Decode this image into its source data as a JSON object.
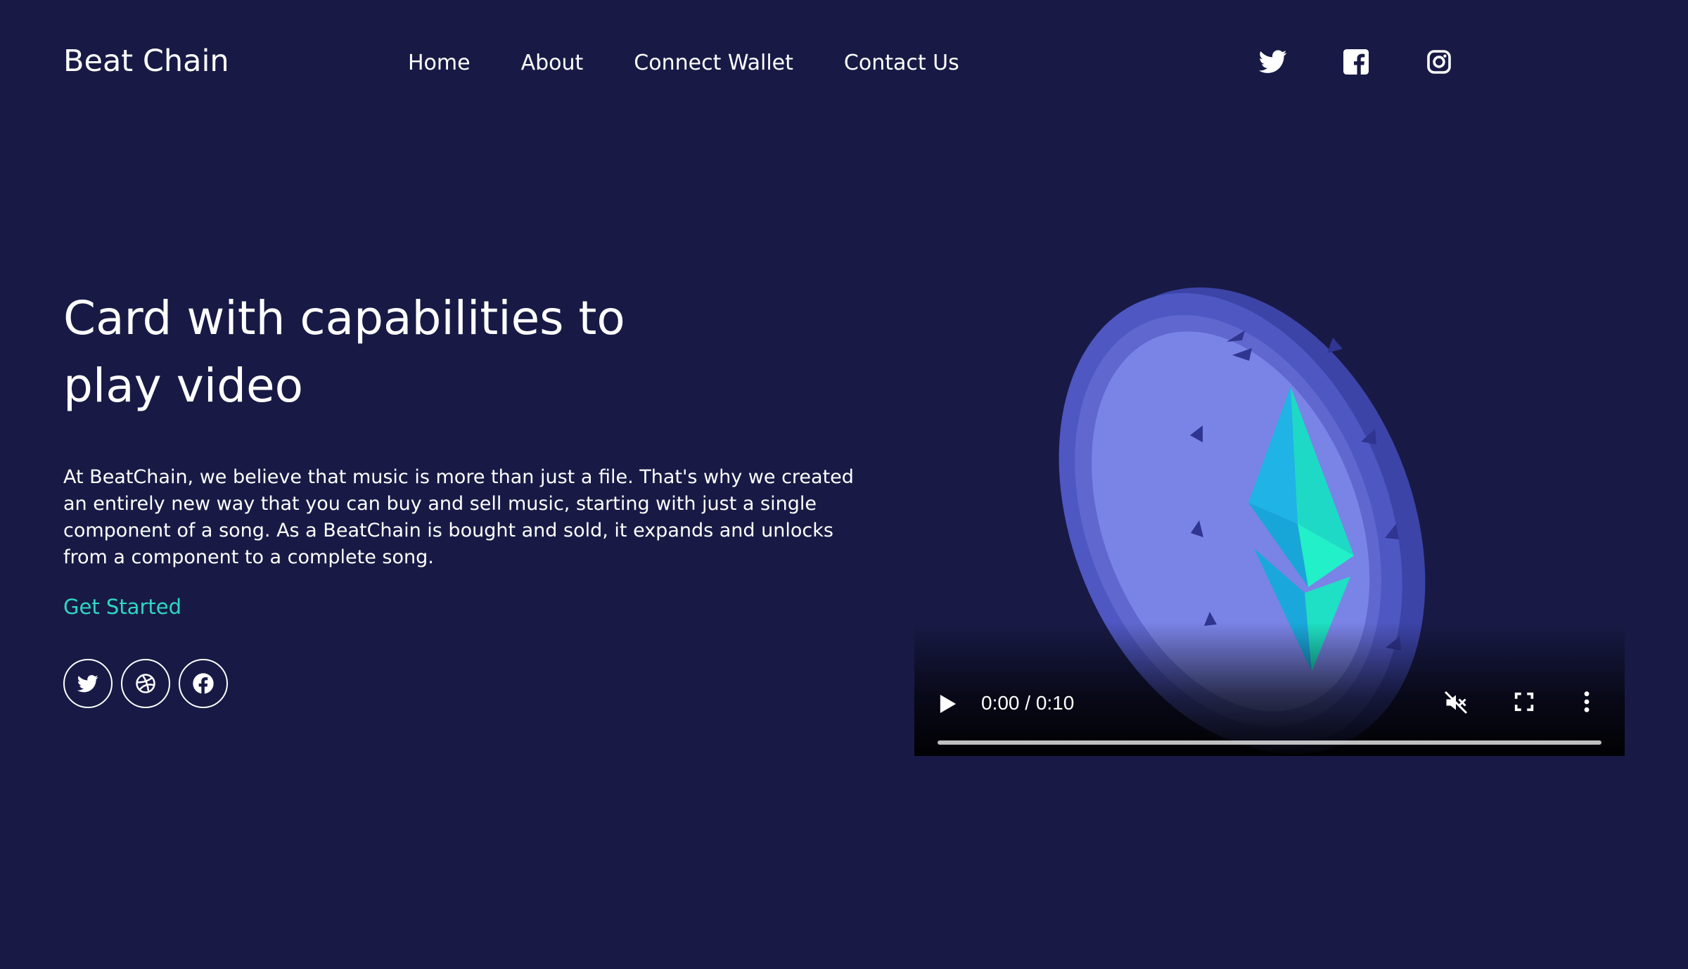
{
  "header": {
    "brand": "Beat Chain",
    "nav": [
      "Home",
      "About",
      "Connect Wallet",
      "Contact Us"
    ],
    "social_icons": [
      "twitter-icon",
      "facebook-icon",
      "instagram-icon"
    ]
  },
  "hero": {
    "headline_line1": "Card with capabilities to",
    "headline_line2": "play video",
    "paragraph": "At BeatChain, we believe that music is more than just a file. That's why we created an entirely new way that you can buy and sell music, starting with just a single component of a song. As a BeatChain is bought and sold, it expands and unlocks from a component to a complete song.",
    "cta": "Get Started",
    "social_circle_icons": [
      "twitter-icon",
      "dribbble-icon",
      "facebook-icon"
    ]
  },
  "video": {
    "time": "0:00 / 0:10",
    "progress": 0,
    "muted": true
  },
  "colors": {
    "background": "#181a45",
    "accent": "#2fd8c4",
    "coin_face": "#7a83e6",
    "coin_rim": "#4f57c2"
  }
}
